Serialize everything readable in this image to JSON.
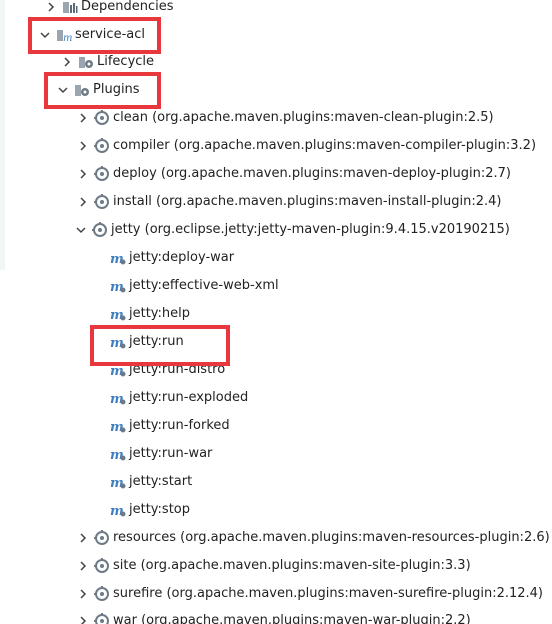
{
  "colors": {
    "highlight": "#e8383d",
    "arrow": "#444444",
    "folder": "#8a9aa8",
    "plugin_gear": "#6e7b86",
    "maven_goal": "#3f7fbf"
  },
  "tree": {
    "dependencies_label": "Dependencies",
    "service_acl_label": "service-acl",
    "lifecycle_label": "Lifecycle",
    "plugins_label": "Plugins",
    "plugins": {
      "clean": "clean (org.apache.maven.plugins:maven-clean-plugin:2.5)",
      "compiler": "compiler (org.apache.maven.plugins:maven-compiler-plugin:3.2)",
      "deploy": "deploy (org.apache.maven.plugins:maven-deploy-plugin:2.7)",
      "install": "install (org.apache.maven.plugins:maven-install-plugin:2.4)",
      "jetty": "jetty (org.eclipse.jetty:jetty-maven-plugin:9.4.15.v20190215)",
      "resources": "resources (org.apache.maven.plugins:maven-resources-plugin:2.6)",
      "site": "site (org.apache.maven.plugins:maven-site-plugin:3.3)",
      "surefire": "surefire (org.apache.maven.plugins:maven-surefire-plugin:2.12.4)",
      "war": "war (org.apache.maven.plugins:maven-war-plugin:2.2)"
    },
    "jetty_goals": {
      "deploy_war": "jetty:deploy-war",
      "effective_web_xml": "jetty:effective-web-xml",
      "help": "jetty:help",
      "run": "jetty:run",
      "run_distro": "jetty:run-distro",
      "run_exploded": "jetty:run-exploded",
      "run_forked": "jetty:run-forked",
      "run_war": "jetty:run-war",
      "start": "jetty:start",
      "stop": "jetty:stop"
    }
  }
}
